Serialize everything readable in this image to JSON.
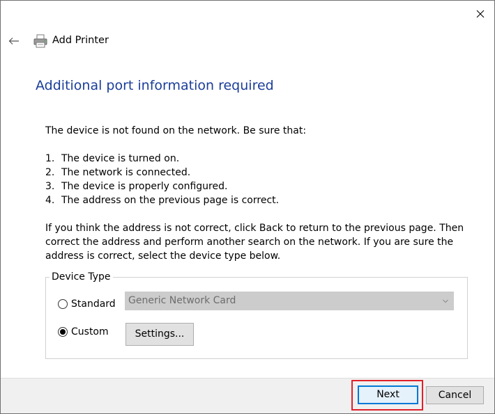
{
  "window": {
    "title": "Add Printer",
    "close_icon": "close-icon",
    "back_icon": "back-arrow-icon",
    "app_icon": "printer-icon"
  },
  "page": {
    "heading": "Additional port information required",
    "intro": "The device is not found on the network.  Be sure that:",
    "checklist": [
      {
        "num": "1.",
        "text": "The device is turned on."
      },
      {
        "num": "2.",
        "text": "The network is connected."
      },
      {
        "num": "3.",
        "text": "The device is properly configured."
      },
      {
        "num": "4.",
        "text": "The address on the previous page is correct."
      }
    ],
    "advice": "If you think the address is not correct, click Back to return to the previous page.  Then correct the address and perform another search on the network.  If you are sure the address is correct, select the device type below."
  },
  "device_type": {
    "legend": "Device Type",
    "standard_label": "Standard",
    "standard_selected": false,
    "standard_value": "Generic Network Card",
    "custom_label": "Custom",
    "custom_selected": true,
    "settings_label": "Settings..."
  },
  "footer": {
    "next_label": "Next",
    "cancel_label": "Cancel"
  },
  "colors": {
    "heading": "#1a3d99",
    "highlight": "#e0202a",
    "default_button_border": "#0078d7",
    "footer_bg": "#f0f0f0"
  }
}
